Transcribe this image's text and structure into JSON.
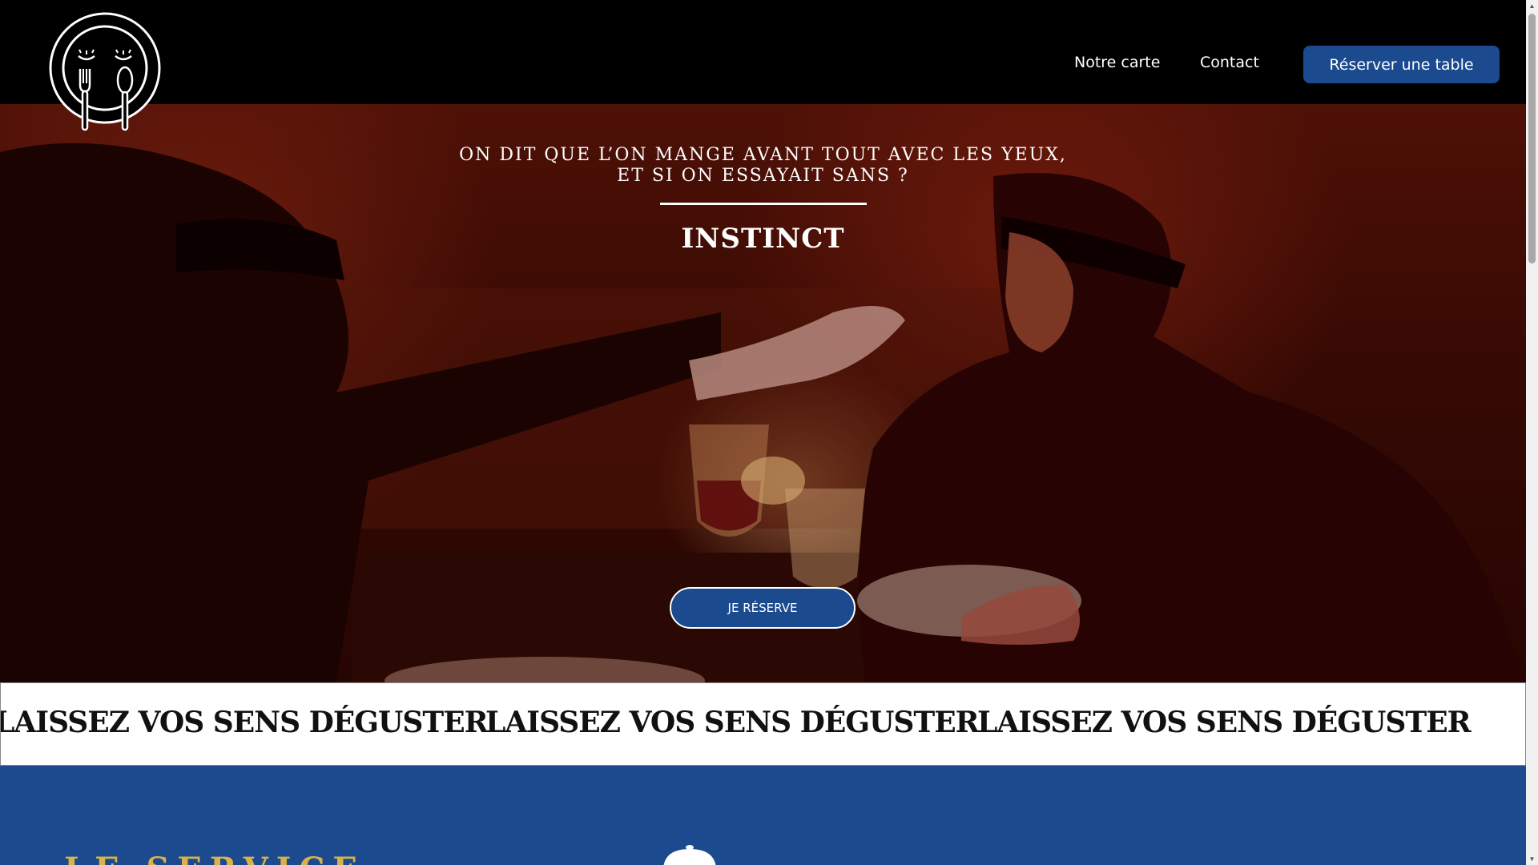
{
  "header": {
    "nav": [
      {
        "label": "Notre carte"
      },
      {
        "label": "Contact"
      }
    ],
    "reserve_button": "Réserver une table"
  },
  "hero": {
    "tagline_line1": "ON DIT QUE L’ON MANGE AVANT TOUT AVEC LES YEUX,",
    "tagline_line2": "ET SI ON ESSAYAIT SANS ?",
    "brand": "INSTINCT",
    "button": "JE RÉSERVE"
  },
  "marquee": {
    "items": [
      "LAISSEZ VOS SENS DÉGUSTER",
      "LAISSEZ VOS SENS DÉGUSTER",
      "LAISSEZ VOS SENS DÉGUSTER"
    ]
  },
  "service": {
    "title": "LE SERVICE"
  },
  "colors": {
    "primary": "#1b4a8e",
    "accent": "#d9b24a",
    "header_bg": "#000000"
  },
  "icons": {
    "logo": "blindfolded-smiley-fork-spoon-logo",
    "service": "cloche-icon"
  }
}
